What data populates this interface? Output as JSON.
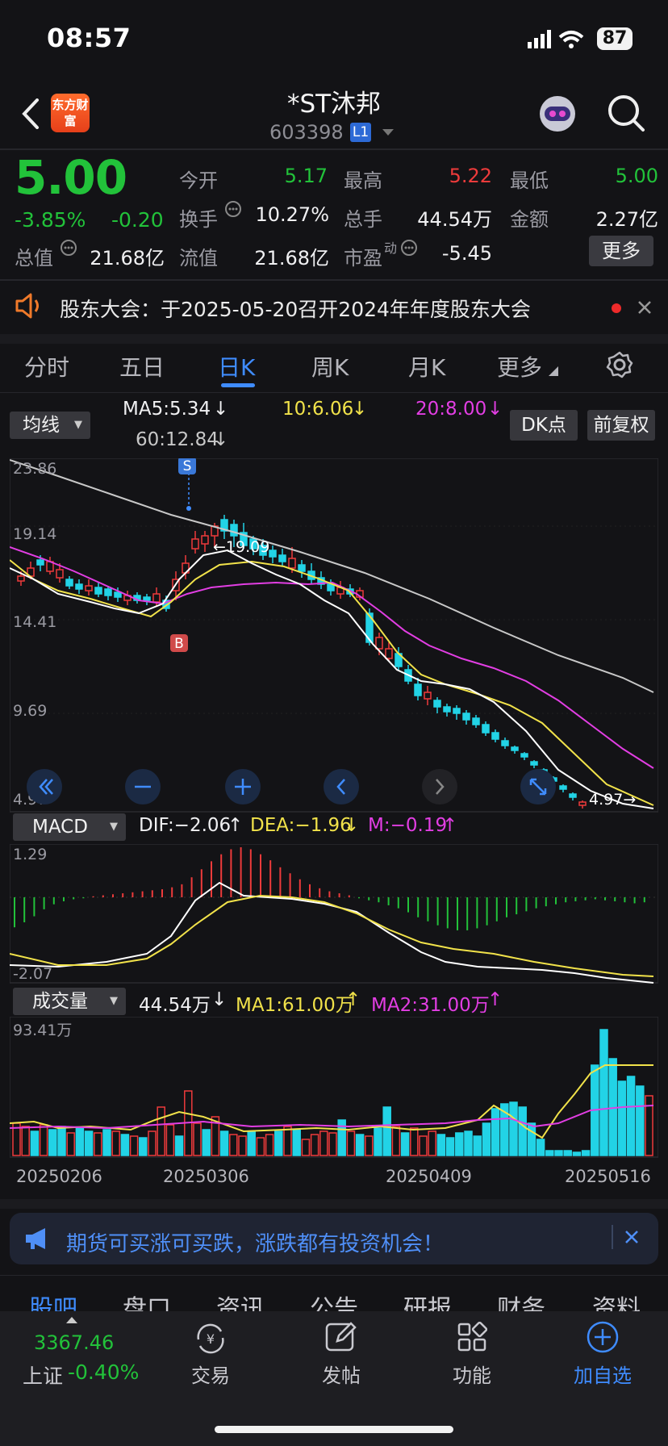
{
  "status_bar": {
    "time": "08:57",
    "battery": "87"
  },
  "header": {
    "title": "*ST沐邦",
    "code": "603398",
    "level": "L1",
    "brand_logo": "东方财富"
  },
  "quote": {
    "price": "5.00",
    "change_pct": "-3.85%",
    "change": "-0.20",
    "open_label": "今开",
    "open": "5.17",
    "high_label": "最高",
    "high": "5.22",
    "low_label": "最低",
    "low": "5.00",
    "turnover_label": "换手",
    "turnover": "10.27%",
    "volume_label": "总手",
    "volume": "44.54万",
    "amount_label": "金额",
    "amount": "2.27亿",
    "mktcap_label": "总值",
    "mktcap": "21.68亿",
    "float_label": "流值",
    "float_cap": "21.68亿",
    "pe_label": "市盈",
    "pe_sup": "动",
    "pe": "-5.45",
    "more_button": "更多"
  },
  "notice": {
    "text": "股东大会：于2025-05-20召开2024年年度股东大会"
  },
  "period_tabs": [
    {
      "label": "分时"
    },
    {
      "label": "五日"
    },
    {
      "label": "日K"
    },
    {
      "label": "周K"
    },
    {
      "label": "月K"
    },
    {
      "label": "更多"
    }
  ],
  "kline_controls": {
    "indicator_select": "均线",
    "ma5": "MA5:5.34",
    "ma10": "10:6.06",
    "ma20": "20:8.00",
    "ma60": "60:12.84",
    "dk_button": "DK点",
    "adjust_button": "前复权"
  },
  "price_axis": {
    "top": "23.86",
    "l2": "19.14",
    "l3": "14.41",
    "l4": "9.69",
    "bottom": "4.97"
  },
  "annotations": {
    "high_marker": "19.09",
    "last_marker": "4.97",
    "sell_flag": "S",
    "buy_flag": "B"
  },
  "macd_panel": {
    "select": "MACD",
    "dif": "DIF:−2.06",
    "dea": "DEA:−1.96",
    "m": "M:−0.19",
    "axis_top": "1.29",
    "axis_bottom": "-2.07"
  },
  "volume_panel": {
    "select": "成交量",
    "vol": "44.54万",
    "ma1": "MA1:61.00万",
    "ma2": "MA2:31.00万",
    "axis_top": "93.41万"
  },
  "date_axis": [
    "20250206",
    "20250306",
    "20250409",
    "20250516"
  ],
  "banner": {
    "text": "期货可买涨可买跌，涨跌都有投资机会！"
  },
  "bottom_tabs": [
    "股吧",
    "盘口",
    "资讯",
    "公告",
    "研报",
    "财务",
    "资料"
  ],
  "bottom_nav": {
    "index_value": "3367.46",
    "index_name": "上证",
    "index_change": "-0.40%",
    "items": [
      {
        "label": "交易"
      },
      {
        "label": "发帖"
      },
      {
        "label": "功能"
      },
      {
        "label": "加自选"
      }
    ]
  },
  "colors": {
    "up": "#ee3b3b",
    "down": "#22c23a",
    "accent": "#3f8cff",
    "ma5": "#ffffff",
    "ma10": "#f1e24a",
    "ma20": "#e23ee3",
    "ma60": "#c8c8c8",
    "down_candle": "#22d3e6"
  },
  "chart_data": {
    "type": "candlestick",
    "price_axis_range": [
      4.97,
      23.86
    ],
    "price_points": [
      {
        "label": "S",
        "value": 19.09
      },
      {
        "label": "last",
        "value": 4.97
      }
    ],
    "indicators": {
      "MA5": 5.34,
      "MA10": 6.06,
      "MA20": 8.0,
      "MA60": 12.84
    },
    "macd": {
      "DIF": -2.06,
      "DEA": -1.96,
      "M": -0.19,
      "range": [
        -2.07,
        1.29
      ]
    },
    "volume": {
      "current": "44.54万",
      "MA1": "61.00万",
      "MA2": "31.00万",
      "max": "93.41万"
    },
    "dates": [
      "20250206",
      "20250306",
      "20250409",
      "20250516"
    ]
  }
}
